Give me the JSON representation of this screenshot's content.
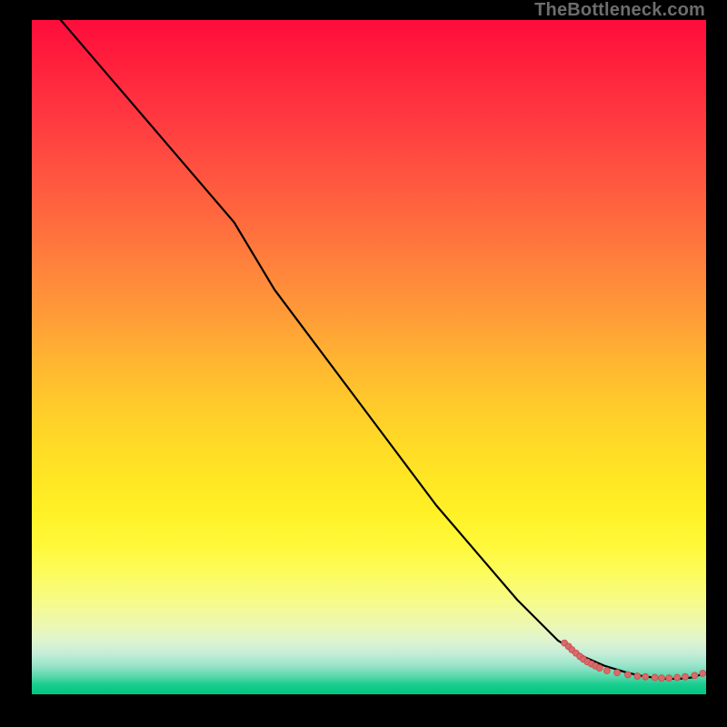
{
  "watermark": "TheBottleneck.com",
  "colors": {
    "curve_stroke": "#000000",
    "marker_fill": "#d86a6a",
    "marker_stroke": "#c84f4f"
  },
  "chart_data": {
    "type": "line",
    "title": "",
    "xlabel": "",
    "ylabel": "",
    "xlim": [
      0,
      100
    ],
    "ylim": [
      0,
      100
    ],
    "grid": false,
    "legend": null,
    "series": [
      {
        "name": "bottleneck-curve",
        "x": [
          0,
          6,
          12,
          18,
          24,
          30,
          36,
          42,
          48,
          54,
          60,
          66,
          72,
          78,
          82,
          85,
          88,
          90,
          92,
          94,
          96,
          98,
          100
        ],
        "y": [
          105,
          98,
          91,
          84,
          77,
          70,
          60,
          52,
          44,
          36,
          28,
          21,
          14,
          8,
          5.5,
          4.2,
          3.3,
          2.8,
          2.5,
          2.3,
          2.3,
          2.5,
          3.2
        ]
      }
    ],
    "markers": {
      "name": "cluster-points",
      "points": [
        {
          "x": 79.0,
          "y": 7.6
        },
        {
          "x": 79.6,
          "y": 7.1
        },
        {
          "x": 80.1,
          "y": 6.6
        },
        {
          "x": 80.7,
          "y": 6.1
        },
        {
          "x": 81.3,
          "y": 5.6
        },
        {
          "x": 81.8,
          "y": 5.2
        },
        {
          "x": 82.4,
          "y": 4.8
        },
        {
          "x": 83.0,
          "y": 4.5
        },
        {
          "x": 83.6,
          "y": 4.2
        },
        {
          "x": 84.2,
          "y": 3.9
        },
        {
          "x": 85.3,
          "y": 3.5
        },
        {
          "x": 86.8,
          "y": 3.2
        },
        {
          "x": 88.4,
          "y": 2.9
        },
        {
          "x": 89.8,
          "y": 2.7
        },
        {
          "x": 91.0,
          "y": 2.6
        },
        {
          "x": 92.4,
          "y": 2.5
        },
        {
          "x": 93.4,
          "y": 2.4
        },
        {
          "x": 94.5,
          "y": 2.4
        },
        {
          "x": 95.7,
          "y": 2.5
        },
        {
          "x": 96.9,
          "y": 2.6
        },
        {
          "x": 98.3,
          "y": 2.8
        },
        {
          "x": 99.5,
          "y": 3.1
        }
      ]
    }
  }
}
